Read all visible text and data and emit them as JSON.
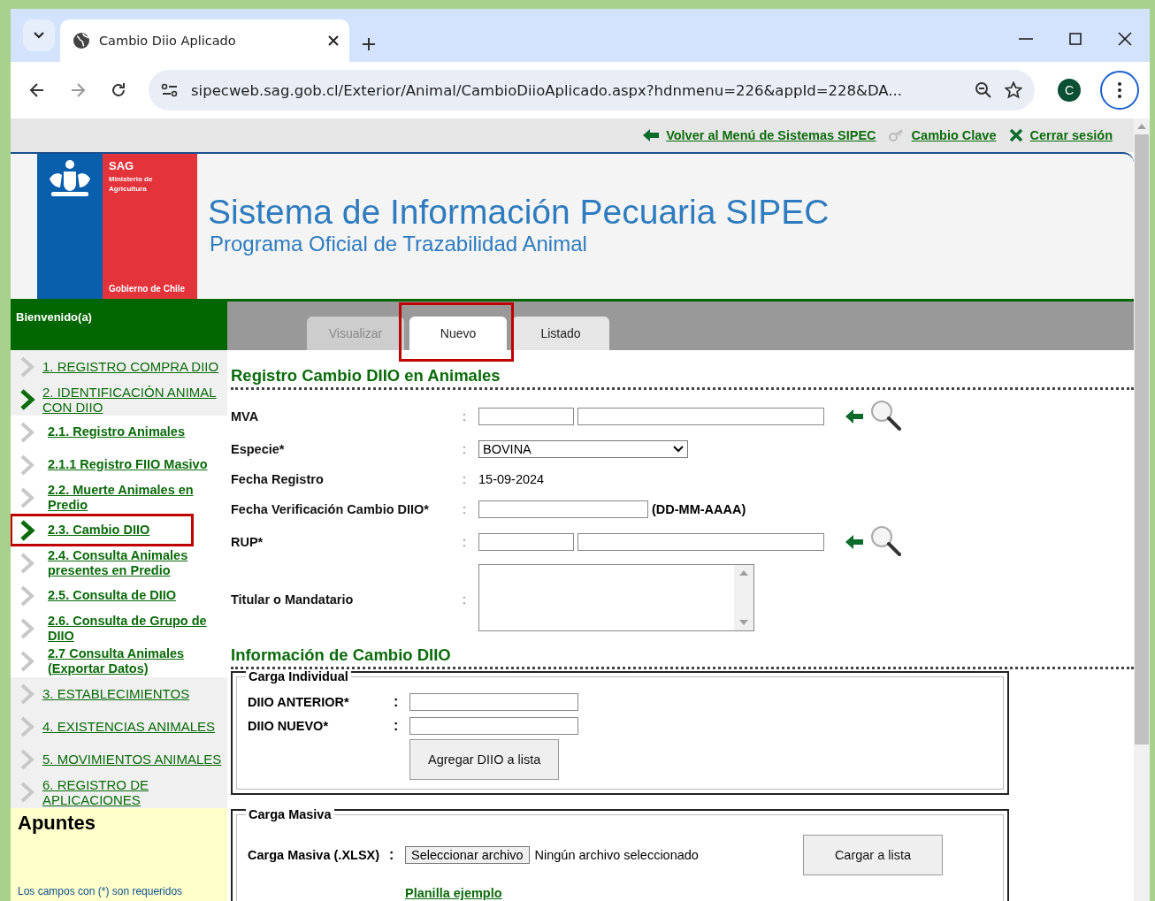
{
  "browser": {
    "tab_title": "Cambio Diio Aplicado",
    "url": "sipecweb.sag.gob.cl/Exterior/Animal/CambioDiioAplicado.aspx?hdnmenu=226&appId=228&DA...",
    "profile_initial": "C"
  },
  "top_links": [
    {
      "kind": "back",
      "label": "Volver al Menú de Sistemas SIPEC"
    },
    {
      "kind": "key",
      "label": "Cambio Clave"
    },
    {
      "kind": "close",
      "label": "Cerrar sesión"
    }
  ],
  "header": {
    "logo": {
      "name": "SAG",
      "ministry": "Ministerio de Agricultura",
      "government": "Gobierno de Chile"
    },
    "title": "Sistema de Información Pecuaria SIPEC",
    "subtitle": "Programa Oficial de Trazabilidad Animal"
  },
  "welcome": "Bienvenido(a)",
  "page_tabs": [
    {
      "label": "Visualizar",
      "selected": false,
      "disabled": true,
      "highlighted": false
    },
    {
      "label": "Nuevo",
      "selected": true,
      "disabled": false,
      "highlighted": true
    },
    {
      "label": "Listado",
      "selected": false,
      "disabled": false,
      "highlighted": false
    }
  ],
  "sidebar": {
    "items": [
      {
        "label": "1. REGISTRO COMPRA DIIO",
        "active": false,
        "highlighted": false
      },
      {
        "label": "2. IDENTIFICACIÓN ANIMAL CON DIIO",
        "active": true,
        "highlighted": false,
        "children": [
          {
            "label": "2.1. Registro Animales",
            "active": false,
            "highlighted": false
          },
          {
            "label": "2.1.1 Registro FIIO Masivo",
            "active": false,
            "highlighted": false
          },
          {
            "label": "2.2. Muerte Animales en Predio",
            "active": false,
            "highlighted": false
          },
          {
            "label": "2.3. Cambio DIIO",
            "active": true,
            "highlighted": true
          },
          {
            "label": "2.4. Consulta Animales presentes en Predio",
            "active": false,
            "highlighted": false
          },
          {
            "label": "2.5. Consulta de DIIO",
            "active": false,
            "highlighted": false
          },
          {
            "label": "2.6. Consulta de Grupo de DIIO",
            "active": false,
            "highlighted": false
          },
          {
            "label": "2.7 Consulta Animales (Exportar Datos)",
            "active": false,
            "highlighted": false
          }
        ]
      },
      {
        "label": "3. ESTABLECIMIENTOS",
        "active": false,
        "highlighted": false
      },
      {
        "label": "4. EXISTENCIAS ANIMALES",
        "active": false,
        "highlighted": false
      },
      {
        "label": "5. MOVIMIENTOS ANIMALES",
        "active": false,
        "highlighted": false
      },
      {
        "label": "6. REGISTRO DE APLICACIONES",
        "active": false,
        "highlighted": false
      }
    ]
  },
  "notes": {
    "title": "Apuntes",
    "text": "Los campos con (*) son requeridos"
  },
  "form": {
    "title": "Registro Cambio DIIO en Animales",
    "rows": [
      {
        "kind": "double",
        "label": "MVA",
        "colon": ":",
        "lookup": true
      },
      {
        "kind": "select",
        "label": "Especie*",
        "colon": ":",
        "value": "BOVINA"
      },
      {
        "kind": "text",
        "label": "Fecha Registro",
        "colon": ":",
        "value": "15-09-2024"
      },
      {
        "kind": "date",
        "label": "Fecha Verificación Cambio DIIO*",
        "colon": ":",
        "hint": "(DD-MM-AAAA)"
      },
      {
        "kind": "double",
        "label": "RUP*",
        "colon": ":",
        "lookup": true
      },
      {
        "kind": "textarea",
        "label": "Titular o Mandatario",
        "colon": ":"
      }
    ]
  },
  "change_info": {
    "title": "Información de Cambio DIIO",
    "individual": {
      "legend": "Carga Individual",
      "fields": [
        {
          "label": "DIIO ANTERIOR*",
          "colon": ":"
        },
        {
          "label": "DIIO NUEVO*",
          "colon": ":"
        }
      ],
      "button": "Agregar DIIO a lista"
    },
    "bulk": {
      "legend": "Carga Masiva",
      "label": "Carga Masiva (.XLSX)",
      "colon": ":",
      "file_button": "Seleccionar archivo",
      "file_status": "Ningún archivo seleccionado",
      "link": "Planilla ejemplo",
      "button": "Cargar a lista"
    }
  }
}
